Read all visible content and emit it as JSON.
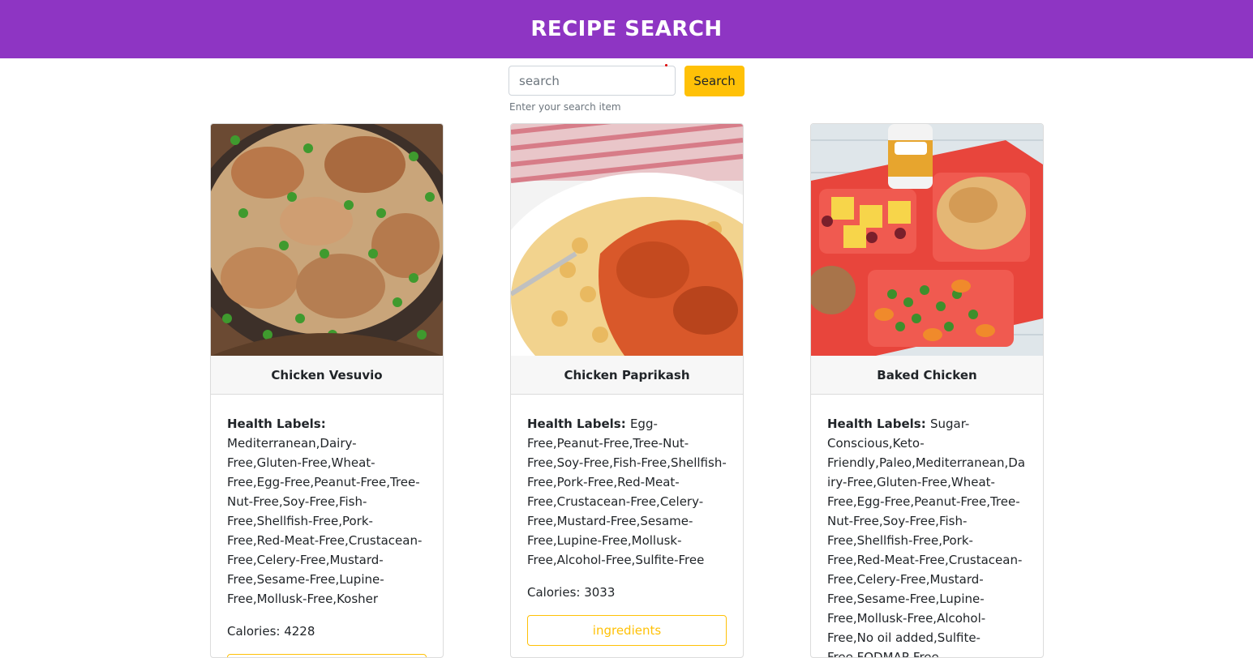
{
  "header": {
    "title": "RECIPE SEARCH"
  },
  "search": {
    "placeholder": "search",
    "value": "",
    "button_label": "Search",
    "hint": "Enter your search item"
  },
  "labels": {
    "health_labels": "Health Labels:",
    "calories_prefix": "Calories: ",
    "ingredients_button": "ingredients"
  },
  "recipes": [
    {
      "title": "Chicken Vesuvio",
      "health_labels": "Mediterranean,Dairy-Free,Gluten-Free,Wheat-Free,Egg-Free,Peanut-Free,Tree-Nut-Free,Soy-Free,Fish-Free,Shellfish-Free,Pork-Free,Red-Meat-Free,Crustacean-Free,Celery-Free,Mustard-Free,Sesame-Free,Lupine-Free,Mollusk-Free,Kosher",
      "calories": "4228",
      "image_icon": "chicken-vesuvio-photo"
    },
    {
      "title": "Chicken Paprikash",
      "health_labels": "Egg-Free,Peanut-Free,Tree-Nut-Free,Soy-Free,Fish-Free,Shellfish-Free,Pork-Free,Red-Meat-Free,Crustacean-Free,Celery-Free,Mustard-Free,Sesame-Free,Lupine-Free,Mollusk-Free,Alcohol-Free,Sulfite-Free",
      "calories": "3033",
      "image_icon": "chicken-paprikash-photo"
    },
    {
      "title": "Baked Chicken",
      "health_labels": "Sugar-Conscious,Keto-Friendly,Paleo,Mediterranean,Dairy-Free,Gluten-Free,Wheat-Free,Egg-Free,Peanut-Free,Tree-Nut-Free,Soy-Free,Fish-Free,Shellfish-Free,Pork-Free,Red-Meat-Free,Crustacean-Free,Celery-Free,Mustard-Free,Sesame-Free,Lupine-Free,Mollusk-Free,Alcohol-Free,No oil added,Sulfite-Free,FODMAP-Free",
      "calories": "",
      "image_icon": "baked-chicken-photo"
    }
  ],
  "colors": {
    "header_bg": "#8e35c3",
    "accent": "#ffc107"
  }
}
